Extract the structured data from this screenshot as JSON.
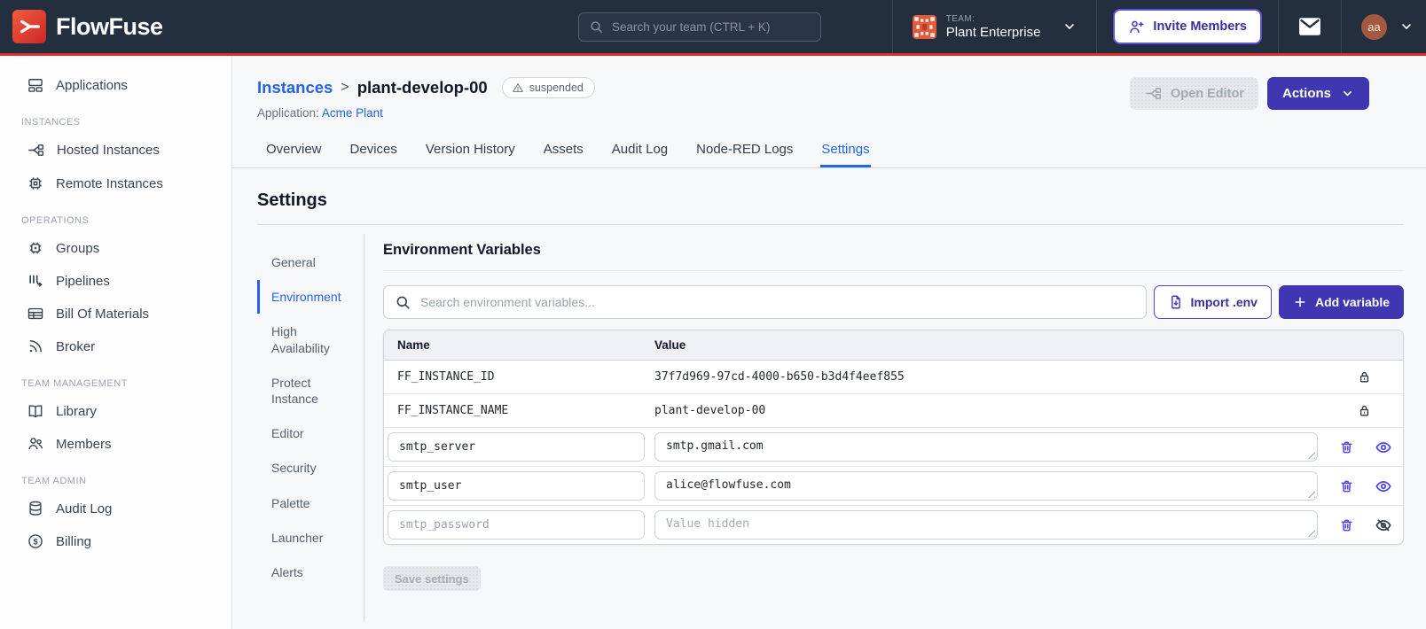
{
  "colors": {
    "navbar_bg": "#232E3F",
    "brand_red": "#E12B26",
    "accent_indigo": "#4136B2",
    "icon_indigo": "#4F46E5",
    "link_blue": "#2563EB",
    "page_bg": "#F7F8FA"
  },
  "navbar": {
    "brand": "FlowFuse",
    "search_placeholder": "Search your team (CTRL + K)",
    "team_label": "TEAM:",
    "team_name": "Plant Enterprise",
    "invite_button": "Invite Members",
    "avatar_initials": "aa"
  },
  "sidebar": {
    "sections": [
      {
        "label": "",
        "items": [
          {
            "label": "Applications",
            "icon": "applications-icon"
          }
        ]
      },
      {
        "label": "INSTANCES",
        "items": [
          {
            "label": "Hosted Instances",
            "icon": "hosted-instances-icon"
          },
          {
            "label": "Remote Instances",
            "icon": "remote-instances-icon"
          }
        ]
      },
      {
        "label": "OPERATIONS",
        "items": [
          {
            "label": "Groups",
            "icon": "groups-icon"
          },
          {
            "label": "Pipelines",
            "icon": "pipelines-icon"
          },
          {
            "label": "Bill Of Materials",
            "icon": "bill-of-materials-icon"
          },
          {
            "label": "Broker",
            "icon": "broker-icon"
          }
        ]
      },
      {
        "label": "TEAM MANAGEMENT",
        "items": [
          {
            "label": "Library",
            "icon": "library-icon"
          },
          {
            "label": "Members",
            "icon": "members-icon"
          }
        ]
      },
      {
        "label": "TEAM ADMIN",
        "items": [
          {
            "label": "Audit Log",
            "icon": "audit-log-icon"
          },
          {
            "label": "Billing",
            "icon": "billing-icon"
          }
        ]
      }
    ]
  },
  "header": {
    "breadcrumb_root": "Instances",
    "breadcrumb_separator": ">",
    "instance_name": "plant-develop-00",
    "status_badge": "suspended",
    "application_label": "Application:",
    "application_name": "Acme Plant",
    "open_editor_label": "Open Editor",
    "actions_label": "Actions"
  },
  "tabs": [
    {
      "label": "Overview"
    },
    {
      "label": "Devices"
    },
    {
      "label": "Version History"
    },
    {
      "label": "Assets"
    },
    {
      "label": "Audit Log"
    },
    {
      "label": "Node-RED Logs"
    },
    {
      "label": "Settings",
      "active": true
    }
  ],
  "settings": {
    "title": "Settings",
    "subnav": [
      {
        "label": "General"
      },
      {
        "label": "Environment",
        "active": true
      },
      {
        "label": "High Availability"
      },
      {
        "label": "Protect Instance"
      },
      {
        "label": "Editor"
      },
      {
        "label": "Security"
      },
      {
        "label": "Palette"
      },
      {
        "label": "Launcher"
      },
      {
        "label": "Alerts"
      }
    ],
    "panel": {
      "title": "Environment Variables",
      "search_placeholder": "Search environment variables...",
      "import_button": "Import .env",
      "add_button": "Add variable",
      "save_button": "Save settings",
      "table": {
        "columns": {
          "name": "Name",
          "value": "Value"
        },
        "locked_rows": [
          {
            "name": "FF_INSTANCE_ID",
            "value": "37f7d969-97cd-4000-b650-b3d4f4eef855"
          },
          {
            "name": "FF_INSTANCE_NAME",
            "value": "plant-develop-00"
          }
        ],
        "editable_rows": [
          {
            "name": "smtp_server",
            "value": "smtp.gmail.com",
            "hidden": false
          },
          {
            "name": "smtp_user",
            "value": "alice@flowfuse.com",
            "hidden": false
          },
          {
            "name": "smtp_password",
            "value": "",
            "value_placeholder": "Value hidden",
            "hidden": true
          }
        ]
      }
    }
  }
}
